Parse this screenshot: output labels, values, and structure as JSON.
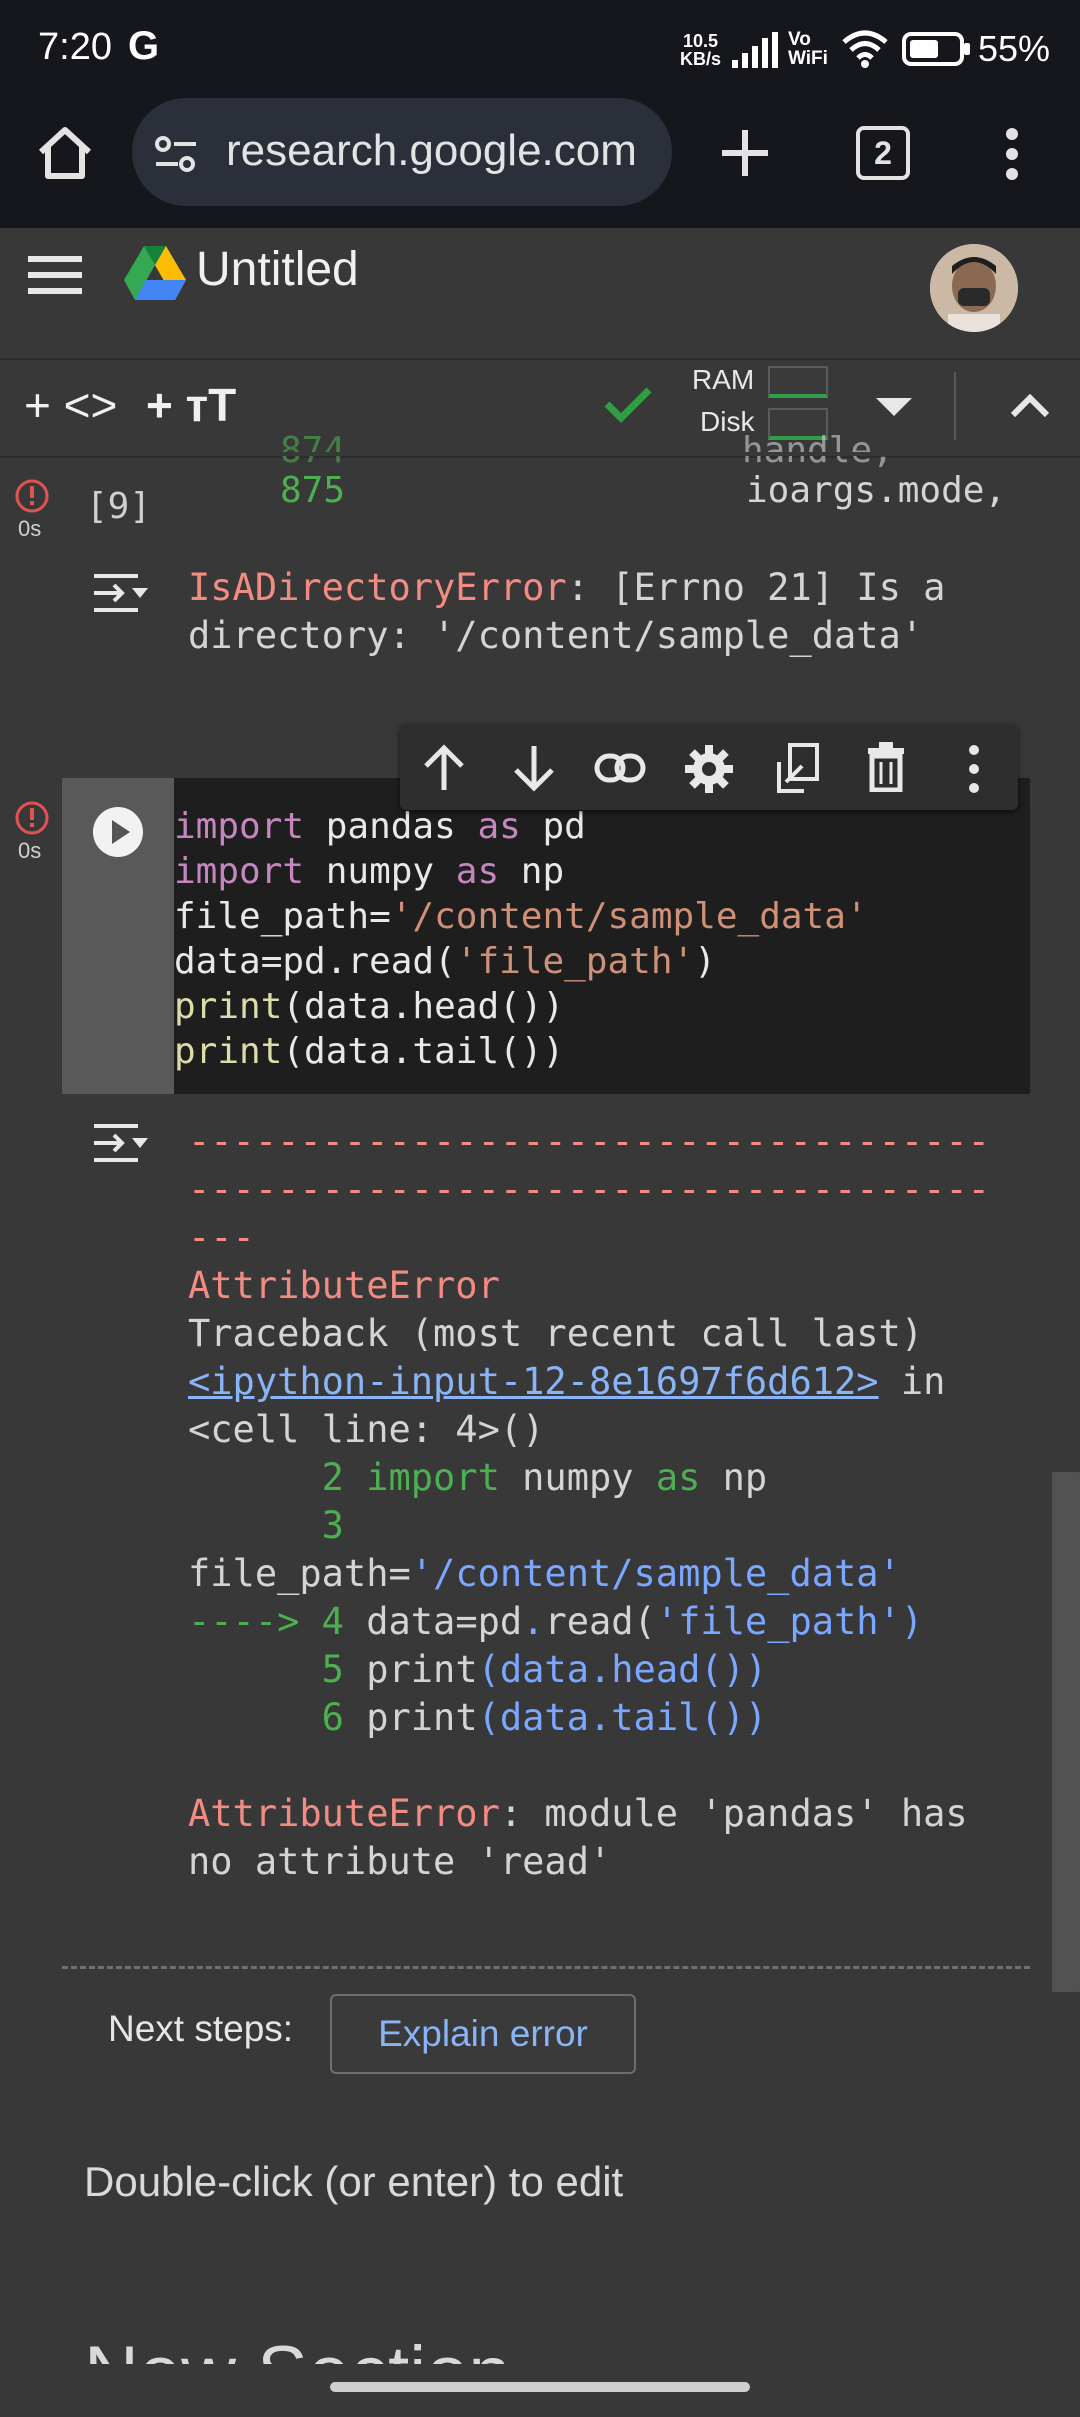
{
  "status_bar": {
    "time": "7:20",
    "g_label": "G",
    "net_speed_value": "10.5",
    "net_speed_unit": "KB/s",
    "volte_top": "Vo",
    "volte_bottom": "WiFi",
    "battery": "55%"
  },
  "browser": {
    "url": "research.google.com",
    "tab_count": "2"
  },
  "colab": {
    "title": "Untitled",
    "toolbar": {
      "add_code": "+ <>",
      "add_text": "+ тT",
      "ram_label": "RAM",
      "disk_label": "Disk"
    }
  },
  "cells": {
    "prev_cell": {
      "exec_time": "0s",
      "exec_count": "[9]",
      "partial_line_left": "875",
      "partial_line_right": "ioargs.mode,",
      "error_name": "IsADirectoryError",
      "error_msg_1": ": [Errno 21] Is a",
      "error_msg_2": "directory: '/content/sample_data'"
    },
    "code_cell": {
      "exec_time": "0s",
      "lines": [
        {
          "kw1": "import",
          "mid": " pandas ",
          "kw2": "as",
          "end": " pd"
        },
        {
          "kw1": "import",
          "mid": " numpy ",
          "kw2": "as",
          "end": " np"
        },
        {
          "plain": "file_path=",
          "str": "'/content/sample_data'"
        },
        {
          "plain": "data=pd.read(",
          "str": "'file_path'",
          "close": ")"
        },
        {
          "fn": "print",
          "rest": "(data.head())"
        },
        {
          "fn": "print",
          "rest": "(data.tail())"
        }
      ]
    },
    "output": {
      "dash1": "------------------------------------",
      "dash2": "------------------------------------",
      "dash3": "---",
      "error_type": "AttributeError",
      "traceback_header": "Traceback (most recent call last)",
      "link": "<ipython-input-12-8e1697f6d612>",
      "in_word": " in",
      "cell_line": "<cell line: 4>()",
      "tb_line2_num": "      2 ",
      "tb_line2_kw1": "import",
      "tb_line2_mid": " numpy ",
      "tb_line2_kw2": "as",
      "tb_line2_end": " np",
      "tb_line3_num": "      3",
      "tb_line3b_plain": "file_path=",
      "tb_line3b_str": "'/content/sample_data'",
      "tb_line4_arrow": "----> 4 ",
      "tb_line4_plain": "data=pd",
      "tb_line4_dot": ".",
      "tb_line4_fn": "read(",
      "tb_line4_str": "'file_path'",
      "tb_line4_close": ")",
      "tb_line5_num": "      5 ",
      "tb_line5_text": "print",
      "tb_line5_rest": "(data",
      "tb_line5_dot": ".",
      "tb_line5_end": "head())",
      "tb_line6_num": "      6 ",
      "tb_line6_text": "print",
      "tb_line6_rest": "(data",
      "tb_line6_dot": ".",
      "tb_line6_end": "tail())",
      "final_error_name": "AttributeError",
      "final_error_msg_1": ": module 'pandas' has",
      "final_error_msg_2": "no attribute 'read'",
      "next_steps_label": "Next steps:",
      "explain_button": "Explain error"
    },
    "text_cell_hint": "Double-click (or enter) to edit",
    "section_heading": "New Section"
  }
}
